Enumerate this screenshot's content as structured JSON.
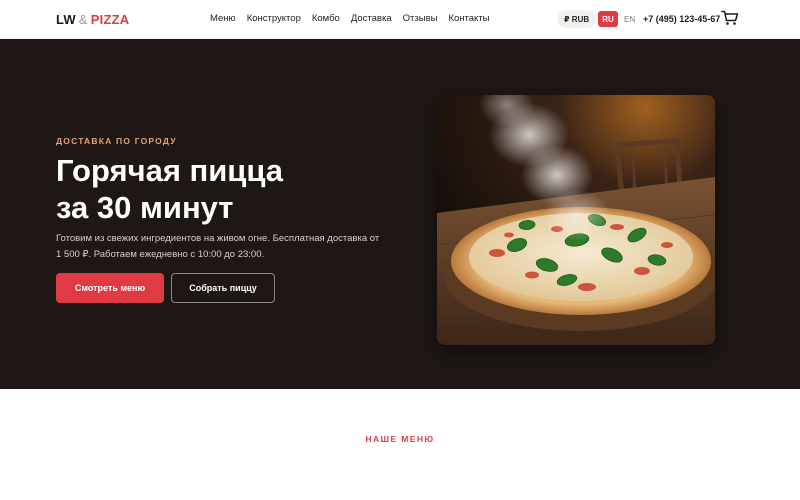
{
  "header": {
    "logo": {
      "part1": "LW",
      "amp": "&",
      "part2": "PIZZA"
    },
    "nav": [
      {
        "label": "Меню"
      },
      {
        "label": "Конструктор"
      },
      {
        "label": "Комбо"
      },
      {
        "label": "Доставка"
      },
      {
        "label": "Отзывы"
      },
      {
        "label": "Контакты"
      }
    ],
    "currency": "₽ RUB",
    "languages": {
      "active": "RU",
      "other": "EN"
    },
    "phone": "+7 (495) 123-45-67",
    "cart_icon": "cart-icon"
  },
  "hero": {
    "eyebrow": "ДОСТАВКА ПО ГОРОДУ",
    "title_line1": "Горячая пицца",
    "title_line2": "за 30 минут",
    "description": "Готовим из свежих ингредиентов на живом огне. Бесплатная доставка от 1 500 ₽. Работаем ежедневно с 10:00 до 23:00.",
    "primary_button": "Смотреть меню",
    "secondary_button": "Собрать пиццу"
  },
  "menu_section": {
    "label": "НАШЕ МЕНЮ"
  },
  "colors": {
    "accent": "#e03b45",
    "hero_bg": "#1e1715",
    "eyebrow": "#e5a46f"
  }
}
